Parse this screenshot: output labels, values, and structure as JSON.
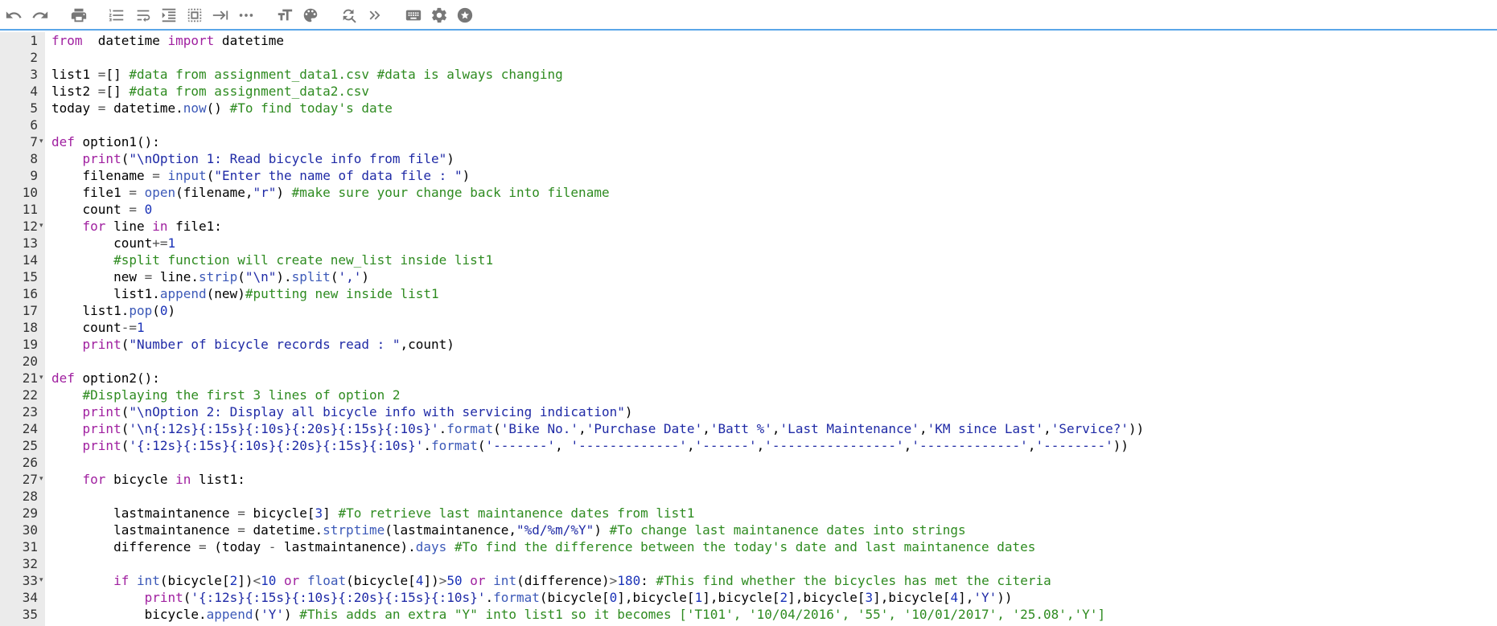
{
  "toolbar": {
    "buttons": [
      {
        "icon": "undo-icon"
      },
      {
        "icon": "redo-icon"
      },
      {
        "icon": "print-icon"
      },
      {
        "icon": "line-numbers-icon"
      },
      {
        "icon": "wrap-icon"
      },
      {
        "icon": "indent-icon"
      },
      {
        "icon": "select-all-icon"
      },
      {
        "icon": "tab-icon"
      },
      {
        "icon": "more-icon"
      },
      {
        "icon": "font-size-icon"
      },
      {
        "icon": "palette-icon"
      },
      {
        "icon": "search-replace-icon"
      },
      {
        "icon": "double-chevron-right-icon"
      },
      {
        "icon": "keyboard-icon"
      },
      {
        "icon": "gear-icon"
      },
      {
        "icon": "star-icon"
      }
    ]
  },
  "editor": {
    "lines": [
      {
        "n": "1",
        "fold": "",
        "segs": [
          [
            "k",
            "from"
          ],
          [
            "",
            "  datetime "
          ],
          [
            "k",
            "import"
          ],
          [
            "",
            " datetime"
          ]
        ]
      },
      {
        "n": "2",
        "fold": "",
        "segs": []
      },
      {
        "n": "3",
        "fold": "",
        "segs": [
          [
            "",
            "list1 "
          ],
          [
            "o",
            "="
          ],
          [
            "",
            "[] "
          ],
          [
            "c",
            "#data from assignment_data1.csv #data is always changing"
          ]
        ]
      },
      {
        "n": "4",
        "fold": "",
        "segs": [
          [
            "",
            "list2 "
          ],
          [
            "o",
            "="
          ],
          [
            "",
            "[] "
          ],
          [
            "c",
            "#data from assignment_data2.csv"
          ]
        ]
      },
      {
        "n": "5",
        "fold": "",
        "segs": [
          [
            "",
            "today "
          ],
          [
            "o",
            "="
          ],
          [
            "",
            " datetime."
          ],
          [
            "b",
            "now"
          ],
          [
            "",
            "() "
          ],
          [
            "c",
            "#To find today's date"
          ]
        ]
      },
      {
        "n": "6",
        "fold": "",
        "segs": []
      },
      {
        "n": "7",
        "fold": "▾",
        "segs": [
          [
            "k",
            "def"
          ],
          [
            "",
            " option1():"
          ]
        ]
      },
      {
        "n": "8",
        "fold": "",
        "segs": [
          [
            "",
            "    "
          ],
          [
            "k",
            "print"
          ],
          [
            "",
            "("
          ],
          [
            "s",
            "\"\\nOption 1: Read bicycle info from file\""
          ],
          [
            "",
            ")"
          ]
        ]
      },
      {
        "n": "9",
        "fold": "",
        "segs": [
          [
            "",
            "    filename "
          ],
          [
            "o",
            "="
          ],
          [
            "",
            " "
          ],
          [
            "b",
            "input"
          ],
          [
            "",
            "("
          ],
          [
            "s",
            "\"Enter the name of data file : \""
          ],
          [
            "",
            ")"
          ]
        ]
      },
      {
        "n": "10",
        "fold": "",
        "segs": [
          [
            "",
            "    file1 "
          ],
          [
            "o",
            "="
          ],
          [
            "",
            " "
          ],
          [
            "b",
            "open"
          ],
          [
            "",
            "(filename,"
          ],
          [
            "s",
            "\"r\""
          ],
          [
            "",
            ") "
          ],
          [
            "c",
            "#make sure your change back into filename"
          ]
        ]
      },
      {
        "n": "11",
        "fold": "",
        "segs": [
          [
            "",
            "    count "
          ],
          [
            "o",
            "="
          ],
          [
            "",
            " "
          ],
          [
            "n",
            "0"
          ]
        ]
      },
      {
        "n": "12",
        "fold": "▾",
        "segs": [
          [
            "",
            "    "
          ],
          [
            "k",
            "for"
          ],
          [
            "",
            " line "
          ],
          [
            "k",
            "in"
          ],
          [
            "",
            " file1:"
          ]
        ]
      },
      {
        "n": "13",
        "fold": "",
        "segs": [
          [
            "",
            "        count"
          ],
          [
            "o",
            "+="
          ],
          [
            "n",
            "1"
          ]
        ]
      },
      {
        "n": "14",
        "fold": "",
        "segs": [
          [
            "",
            "        "
          ],
          [
            "c",
            "#split function will create new_list inside list1"
          ]
        ]
      },
      {
        "n": "15",
        "fold": "",
        "segs": [
          [
            "",
            "        new "
          ],
          [
            "o",
            "="
          ],
          [
            "",
            " line."
          ],
          [
            "b",
            "strip"
          ],
          [
            "",
            "("
          ],
          [
            "s",
            "\"\\n\""
          ],
          [
            "",
            ")."
          ],
          [
            "b",
            "split"
          ],
          [
            "",
            "("
          ],
          [
            "s",
            "','"
          ],
          [
            "",
            ")"
          ]
        ]
      },
      {
        "n": "16",
        "fold": "",
        "segs": [
          [
            "",
            "        list1."
          ],
          [
            "b",
            "append"
          ],
          [
            "",
            "(new)"
          ],
          [
            "c",
            "#putting new inside list1"
          ]
        ]
      },
      {
        "n": "17",
        "fold": "",
        "segs": [
          [
            "",
            "    list1."
          ],
          [
            "b",
            "pop"
          ],
          [
            "",
            "("
          ],
          [
            "n",
            "0"
          ],
          [
            "",
            ")"
          ]
        ]
      },
      {
        "n": "18",
        "fold": "",
        "segs": [
          [
            "",
            "    count"
          ],
          [
            "o",
            "-="
          ],
          [
            "n",
            "1"
          ]
        ]
      },
      {
        "n": "19",
        "fold": "",
        "segs": [
          [
            "",
            "    "
          ],
          [
            "k",
            "print"
          ],
          [
            "",
            "("
          ],
          [
            "s",
            "\"Number of bicycle records read : \""
          ],
          [
            "",
            ",count)"
          ]
        ]
      },
      {
        "n": "20",
        "fold": "",
        "segs": []
      },
      {
        "n": "21",
        "fold": "▾",
        "segs": [
          [
            "k",
            "def"
          ],
          [
            "",
            " option2():"
          ]
        ]
      },
      {
        "n": "22",
        "fold": "",
        "segs": [
          [
            "",
            "    "
          ],
          [
            "c",
            "#Displaying the first 3 lines of option 2"
          ]
        ]
      },
      {
        "n": "23",
        "fold": "",
        "segs": [
          [
            "",
            "    "
          ],
          [
            "k",
            "print"
          ],
          [
            "",
            "("
          ],
          [
            "s",
            "\"\\nOption 2: Display all bicycle info with servicing indication\""
          ],
          [
            "",
            ")"
          ]
        ]
      },
      {
        "n": "24",
        "fold": "",
        "segs": [
          [
            "",
            "    "
          ],
          [
            "k",
            "print"
          ],
          [
            "",
            "("
          ],
          [
            "s",
            "'\\n{:12s}{:15s}{:10s}{:20s}{:15s}{:10s}'"
          ],
          [
            "",
            "."
          ],
          [
            "b",
            "format"
          ],
          [
            "",
            "("
          ],
          [
            "s",
            "'Bike No.'"
          ],
          [
            "",
            ","
          ],
          [
            "s",
            "'Purchase Date'"
          ],
          [
            "",
            ","
          ],
          [
            "s",
            "'Batt %'"
          ],
          [
            "",
            ","
          ],
          [
            "s",
            "'Last Maintenance'"
          ],
          [
            "",
            ","
          ],
          [
            "s",
            "'KM since Last'"
          ],
          [
            "",
            ","
          ],
          [
            "s",
            "'Service?'"
          ],
          [
            "",
            "))"
          ]
        ]
      },
      {
        "n": "25",
        "fold": "",
        "segs": [
          [
            "",
            "    "
          ],
          [
            "k",
            "print"
          ],
          [
            "",
            "("
          ],
          [
            "s",
            "'{:12s}{:15s}{:10s}{:20s}{:15s}{:10s}'"
          ],
          [
            "",
            "."
          ],
          [
            "b",
            "format"
          ],
          [
            "",
            "("
          ],
          [
            "s",
            "'-------'"
          ],
          [
            "",
            ", "
          ],
          [
            "s",
            "'-------------'"
          ],
          [
            "",
            ","
          ],
          [
            "s",
            "'------'"
          ],
          [
            "",
            ","
          ],
          [
            "s",
            "'----------------'"
          ],
          [
            "",
            ","
          ],
          [
            "s",
            "'-------------'"
          ],
          [
            "",
            ","
          ],
          [
            "s",
            "'--------'"
          ],
          [
            "",
            "))"
          ]
        ]
      },
      {
        "n": "26",
        "fold": "",
        "segs": []
      },
      {
        "n": "27",
        "fold": "▾",
        "segs": [
          [
            "",
            "    "
          ],
          [
            "k",
            "for"
          ],
          [
            "",
            " bicycle "
          ],
          [
            "k",
            "in"
          ],
          [
            "",
            " list1:"
          ]
        ]
      },
      {
        "n": "28",
        "fold": "",
        "segs": []
      },
      {
        "n": "29",
        "fold": "",
        "segs": [
          [
            "",
            "        lastmaintanence "
          ],
          [
            "o",
            "="
          ],
          [
            "",
            " bicycle["
          ],
          [
            "n",
            "3"
          ],
          [
            "",
            "] "
          ],
          [
            "c",
            "#To retrieve last maintanence dates from list1"
          ]
        ]
      },
      {
        "n": "30",
        "fold": "",
        "segs": [
          [
            "",
            "        lastmaintanence "
          ],
          [
            "o",
            "="
          ],
          [
            "",
            " datetime."
          ],
          [
            "b",
            "strptime"
          ],
          [
            "",
            "(lastmaintanence,"
          ],
          [
            "s",
            "\"%d/%m/%Y\""
          ],
          [
            "",
            ") "
          ],
          [
            "c",
            "#To change last maintanence dates into strings"
          ]
        ]
      },
      {
        "n": "31",
        "fold": "",
        "segs": [
          [
            "",
            "        difference "
          ],
          [
            "o",
            "="
          ],
          [
            "",
            " (today "
          ],
          [
            "o",
            "-"
          ],
          [
            "",
            " lastmaintanence)."
          ],
          [
            "b",
            "days"
          ],
          [
            "",
            " "
          ],
          [
            "c",
            "#To find the difference between the today's date and last maintanence dates"
          ]
        ]
      },
      {
        "n": "32",
        "fold": "",
        "segs": []
      },
      {
        "n": "33",
        "fold": "▾",
        "segs": [
          [
            "",
            "        "
          ],
          [
            "k",
            "if"
          ],
          [
            "",
            " "
          ],
          [
            "b",
            "int"
          ],
          [
            "",
            "(bicycle["
          ],
          [
            "n",
            "2"
          ],
          [
            "",
            "])"
          ],
          [
            "o",
            "<"
          ],
          [
            "n",
            "10"
          ],
          [
            "",
            " "
          ],
          [
            "k",
            "or"
          ],
          [
            "",
            " "
          ],
          [
            "b",
            "float"
          ],
          [
            "",
            "(bicycle["
          ],
          [
            "n",
            "4"
          ],
          [
            "",
            "])"
          ],
          [
            "o",
            ">"
          ],
          [
            "n",
            "50"
          ],
          [
            "",
            " "
          ],
          [
            "k",
            "or"
          ],
          [
            "",
            " "
          ],
          [
            "b",
            "int"
          ],
          [
            "",
            "(difference)"
          ],
          [
            "o",
            ">"
          ],
          [
            "n",
            "180"
          ],
          [
            "",
            ": "
          ],
          [
            "c",
            "#This find whether the bicycles has met the citeria"
          ]
        ]
      },
      {
        "n": "34",
        "fold": "",
        "segs": [
          [
            "",
            "            "
          ],
          [
            "k",
            "print"
          ],
          [
            "",
            "("
          ],
          [
            "s",
            "'{:12s}{:15s}{:10s}{:20s}{:15s}{:10s}'"
          ],
          [
            "",
            "."
          ],
          [
            "b",
            "format"
          ],
          [
            "",
            "(bicycle["
          ],
          [
            "n",
            "0"
          ],
          [
            "",
            "],bicycle["
          ],
          [
            "n",
            "1"
          ],
          [
            "",
            "],bicycle["
          ],
          [
            "n",
            "2"
          ],
          [
            "",
            "],bicycle["
          ],
          [
            "n",
            "3"
          ],
          [
            "",
            "],bicycle["
          ],
          [
            "n",
            "4"
          ],
          [
            "",
            "],"
          ],
          [
            "s",
            "'Y'"
          ],
          [
            "",
            "))"
          ]
        ]
      },
      {
        "n": "35",
        "fold": "",
        "segs": [
          [
            "",
            "            bicycle."
          ],
          [
            "b",
            "append"
          ],
          [
            "",
            "("
          ],
          [
            "s",
            "'Y'"
          ],
          [
            "",
            ") "
          ],
          [
            "c",
            "#This adds an extra \"Y\" into list1 so it becomes ['T101', '10/04/2016', '55', '10/01/2017', '25.08','Y']"
          ]
        ]
      }
    ]
  }
}
